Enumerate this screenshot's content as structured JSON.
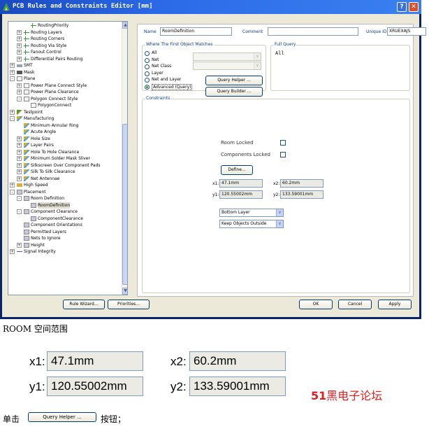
{
  "window": {
    "title": "PCB Rules and Constraints Editor [mm]"
  },
  "tree": {
    "items": [
      {
        "label": "RoutingPriority",
        "icon": "routing-icon",
        "pm": ""
      },
      {
        "label": "Routing Layers",
        "icon": "routing-icon",
        "pm": "+"
      },
      {
        "label": "Routing Corners",
        "icon": "routing-icon",
        "pm": "+"
      },
      {
        "label": "Routing Via Style",
        "icon": "routing-icon",
        "pm": "+"
      },
      {
        "label": "Fanout Control",
        "icon": "routing-icon",
        "pm": "+"
      },
      {
        "label": "Differential Pairs Routing",
        "icon": "routing-icon",
        "pm": "+"
      },
      {
        "label": "SMT",
        "icon": "smt-icon",
        "pm": "+"
      },
      {
        "label": "Mask",
        "icon": "mask-icon",
        "pm": "+"
      },
      {
        "label": "Plane",
        "icon": "plane-icon",
        "pm": "-"
      },
      {
        "label": "Power Plane Connect Style",
        "icon": "plane-icon",
        "pm": "+"
      },
      {
        "label": "Power Plane Clearance",
        "icon": "plane-icon",
        "pm": "+"
      },
      {
        "label": "Polygon Connect Style",
        "icon": "plane-icon",
        "pm": "-"
      },
      {
        "label": "PolygonConnect",
        "icon": "plane-icon",
        "pm": ""
      },
      {
        "label": "Testpoint",
        "icon": "testpoint-icon",
        "pm": "+"
      },
      {
        "label": "Manufacturing",
        "icon": "manufacturing-icon",
        "pm": "-"
      },
      {
        "label": "Minimum Annular Ring",
        "icon": "manufacturing-icon",
        "pm": ""
      },
      {
        "label": "Acute Angle",
        "icon": "manufacturing-icon",
        "pm": ""
      },
      {
        "label": "Hole Size",
        "icon": "manufacturing-icon",
        "pm": "+"
      },
      {
        "label": "Layer Pairs",
        "icon": "manufacturing-icon",
        "pm": "+"
      },
      {
        "label": "Hole To Hole Clearance",
        "icon": "manufacturing-icon",
        "pm": "+"
      },
      {
        "label": "Minimum Solder Mask Sliver",
        "icon": "manufacturing-icon",
        "pm": "+"
      },
      {
        "label": "Silkscreen Over Component Pads",
        "icon": "manufacturing-icon",
        "pm": "+"
      },
      {
        "label": "Silk To Silk Clearance",
        "icon": "manufacturing-icon",
        "pm": "+"
      },
      {
        "label": "Net Antennae",
        "icon": "manufacturing-icon",
        "pm": "+"
      },
      {
        "label": "High Speed",
        "icon": "high-speed-icon",
        "pm": "+"
      },
      {
        "label": "Placement",
        "icon": "placement-icon",
        "pm": "-"
      },
      {
        "label": "Room Definition",
        "icon": "placement-icon",
        "pm": "-"
      },
      {
        "label": "RoomDefinition",
        "icon": "placement-icon",
        "pm": "",
        "selected": true
      },
      {
        "label": "Component Clearance",
        "icon": "placement-icon",
        "pm": "-"
      },
      {
        "label": "ComponentClearance",
        "icon": "placement-icon",
        "pm": ""
      },
      {
        "label": "Component Orientations",
        "icon": "placement-icon",
        "pm": ""
      },
      {
        "label": "Permitted Layers",
        "icon": "placement-icon",
        "pm": ""
      },
      {
        "label": "Nets to Ignore",
        "icon": "placement-icon",
        "pm": ""
      },
      {
        "label": "Height",
        "icon": "placement-icon",
        "pm": "+"
      },
      {
        "label": "Signal Integrity",
        "icon": "signal-integrity-icon",
        "pm": "+"
      }
    ]
  },
  "rule": {
    "name_label": "Name",
    "name_value": "RoomDefinition",
    "comment_label": "Comment",
    "comment_value": "",
    "uid_label": "Unique ID",
    "uid_value": "XRUEXAJS"
  },
  "where": {
    "title": "Where The First Object Matches",
    "options": [
      "All",
      "Net",
      "Net Class",
      "Layer",
      "Net and Layer",
      "Advanced (Query)"
    ],
    "selected_index": 5,
    "query_helper": "Query Helper ...",
    "query_builder": "Query Builder ..."
  },
  "full_query": {
    "title": "Full Query",
    "text": "All"
  },
  "constraints": {
    "title": "Constraints",
    "room_locked": "Room Locked",
    "components_locked": "Components Locked",
    "define": "Define...",
    "x1_label": "x1:",
    "x1": "47.1mm",
    "x2_label": "x2:",
    "x2": "60.2mm",
    "y1_label": "y1:",
    "y1": "120.55002mm",
    "y2_label": "y2:",
    "y2": "133.59001mm",
    "layer": "Bottom Layer",
    "keep": "Keep Objects Outside"
  },
  "buttons": {
    "rule_wizard": "Rule Wizard...",
    "priorities": "Priorities...",
    "ok": "OK",
    "cancel": "Cancel",
    "apply": "Apply"
  },
  "caption1": "ROOM 空间范围",
  "zoom": {
    "x1_label": "x1:",
    "x1": "47.1mm",
    "x2_label": "x2:",
    "x2": "60.2mm",
    "y1_label": "y1:",
    "y1": "120.55002mm",
    "y2_label": "y2:",
    "y2": "133.59001mm"
  },
  "watermark": {
    "num": "51",
    "text": "黑电子论坛"
  },
  "caption2": {
    "prefix": "单击",
    "button": "Query Helper ...",
    "suffix": "按钮；"
  }
}
